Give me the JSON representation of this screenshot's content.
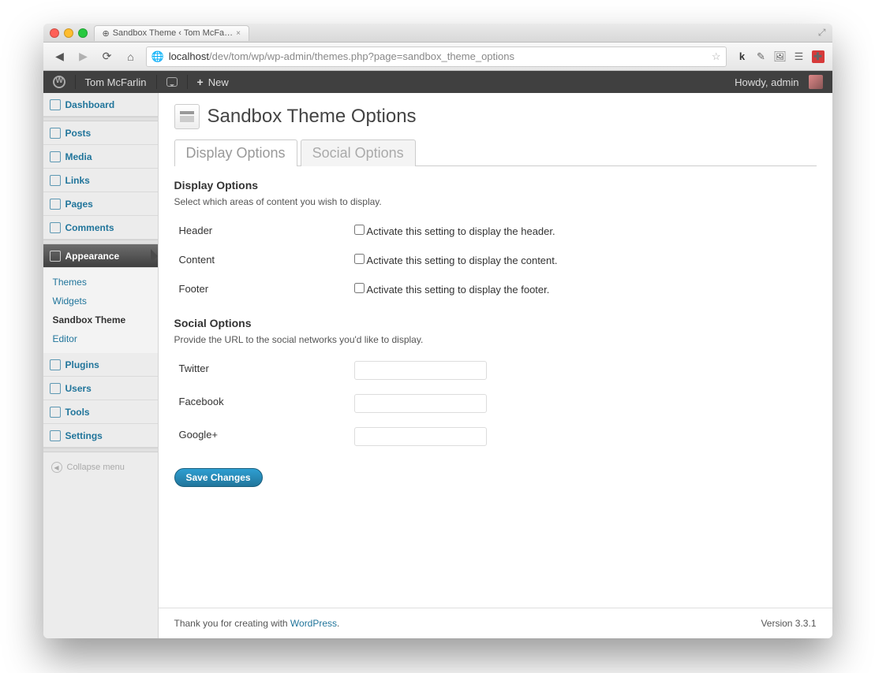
{
  "browser": {
    "tab_title": "Sandbox Theme ‹ Tom McFa…",
    "url_host": "localhost",
    "url_path": "/dev/tom/wp/wp-admin/themes.php?page=sandbox_theme_options"
  },
  "adminbar": {
    "site_name": "Tom McFarlin",
    "new_label": "New",
    "howdy": "Howdy, admin"
  },
  "sidebar": {
    "items": [
      {
        "label": "Dashboard"
      },
      {
        "label": "Posts"
      },
      {
        "label": "Media"
      },
      {
        "label": "Links"
      },
      {
        "label": "Pages"
      },
      {
        "label": "Comments"
      },
      {
        "label": "Appearance"
      },
      {
        "label": "Plugins"
      },
      {
        "label": "Users"
      },
      {
        "label": "Tools"
      },
      {
        "label": "Settings"
      }
    ],
    "submenu": [
      {
        "label": "Themes"
      },
      {
        "label": "Widgets"
      },
      {
        "label": "Sandbox Theme"
      },
      {
        "label": "Editor"
      }
    ],
    "collapse": "Collapse menu"
  },
  "page": {
    "title": "Sandbox Theme Options",
    "tabs": [
      {
        "label": "Display Options"
      },
      {
        "label": "Social Options"
      }
    ],
    "display": {
      "heading": "Display Options",
      "desc": "Select which areas of content you wish to display.",
      "rows": [
        {
          "label": "Header",
          "text": "Activate this setting to display the header."
        },
        {
          "label": "Content",
          "text": "Activate this setting to display the content."
        },
        {
          "label": "Footer",
          "text": "Activate this setting to display the footer."
        }
      ]
    },
    "social": {
      "heading": "Social Options",
      "desc": "Provide the URL to the social networks you'd like to display.",
      "rows": [
        {
          "label": "Twitter"
        },
        {
          "label": "Facebook"
        },
        {
          "label": "Google+"
        }
      ]
    },
    "submit": "Save Changes"
  },
  "footer": {
    "thanks_prefix": "Thank you for creating with ",
    "thanks_link": "WordPress",
    "thanks_suffix": ".",
    "version": "Version 3.3.1"
  }
}
